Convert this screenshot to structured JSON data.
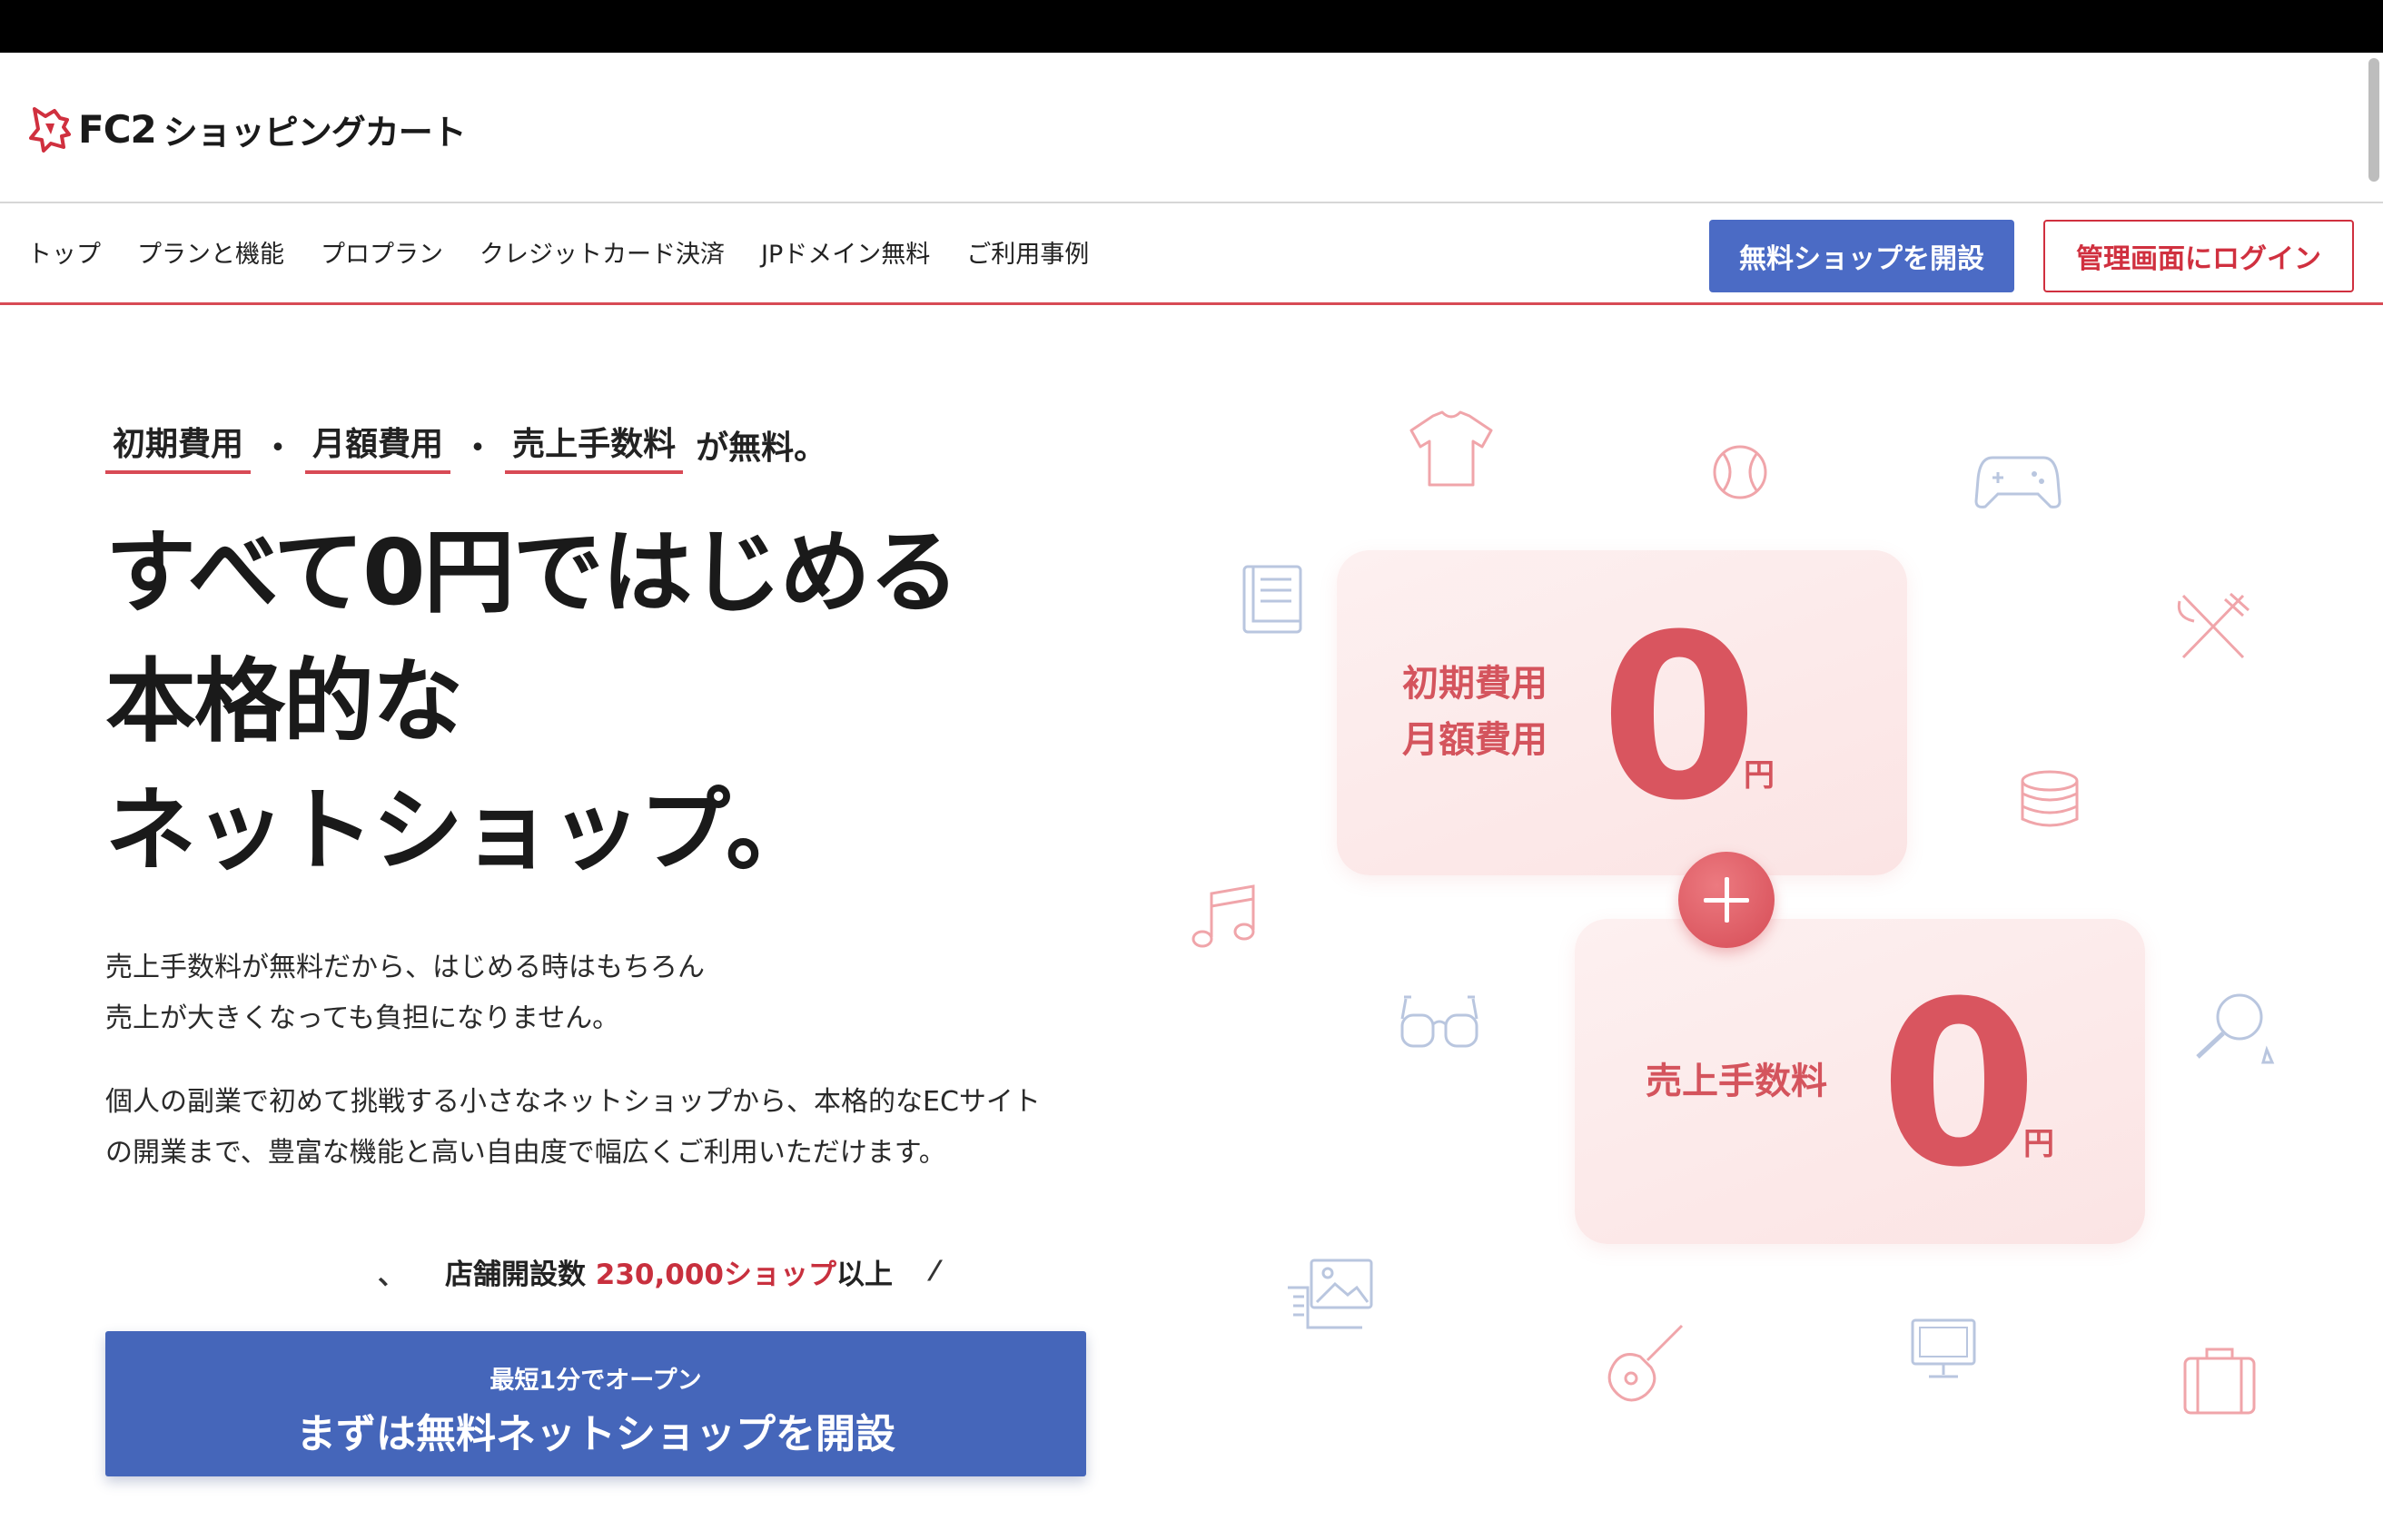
{
  "header": {
    "logo_brand": "FC2",
    "logo_name": "ショッピングカート"
  },
  "nav": {
    "items": [
      {
        "label": "トップ"
      },
      {
        "label": "プランと機能"
      },
      {
        "label": "プロプラン"
      },
      {
        "label": "クレジットカード決済"
      },
      {
        "label": "JPドメイン無料"
      },
      {
        "label": "ご利用事例"
      }
    ],
    "open_shop_button": "無料ショップを開設",
    "login_button": "管理画面にログイン"
  },
  "hero": {
    "tag_items": [
      "初期費用",
      "月額費用",
      "売上手数料"
    ],
    "tag_separator": "・",
    "tag_suffix": "が無料。",
    "headline_lines": [
      "すべて0円ではじめる",
      "本格的な",
      "ネットショップ。"
    ],
    "desc1_lines": [
      "売上手数料が無料だから、はじめる時はもちろん",
      "売上が大きくなっても負担になりません。"
    ],
    "desc2_lines": [
      "個人の副業で初めて挑戦する小さなネットショップから、本格的なECサイト",
      "の開業まで、豊富な機能と高い自由度で幅広くご利用いただけます。"
    ],
    "count_slash_left": "、",
    "count_prefix": "店舗開設数",
    "count_number": "230,000ショップ",
    "count_suffix": "以上",
    "count_slash_right": "⁄",
    "cta_sub": "最短1分でオープン",
    "cta_main": "まずは無料ネットショップを開設"
  },
  "cards": {
    "card1_label_lines": [
      "初期費用",
      "月額費用"
    ],
    "card2_label": "売上手数料",
    "zero": "0",
    "yen": "円"
  },
  "colors": {
    "accent_red": "#d84a55",
    "primary_blue": "#4566ba",
    "nav_blue": "#4b6bc5"
  },
  "icons": [
    "tshirt-icon",
    "baseball-icon",
    "gamepad-icon",
    "book-icon",
    "utensils-icon",
    "pancake-icon",
    "music-icon",
    "glasses-icon",
    "magnifier-icon",
    "images-icon",
    "guitar-icon",
    "monitor-icon",
    "suitcase-icon"
  ]
}
